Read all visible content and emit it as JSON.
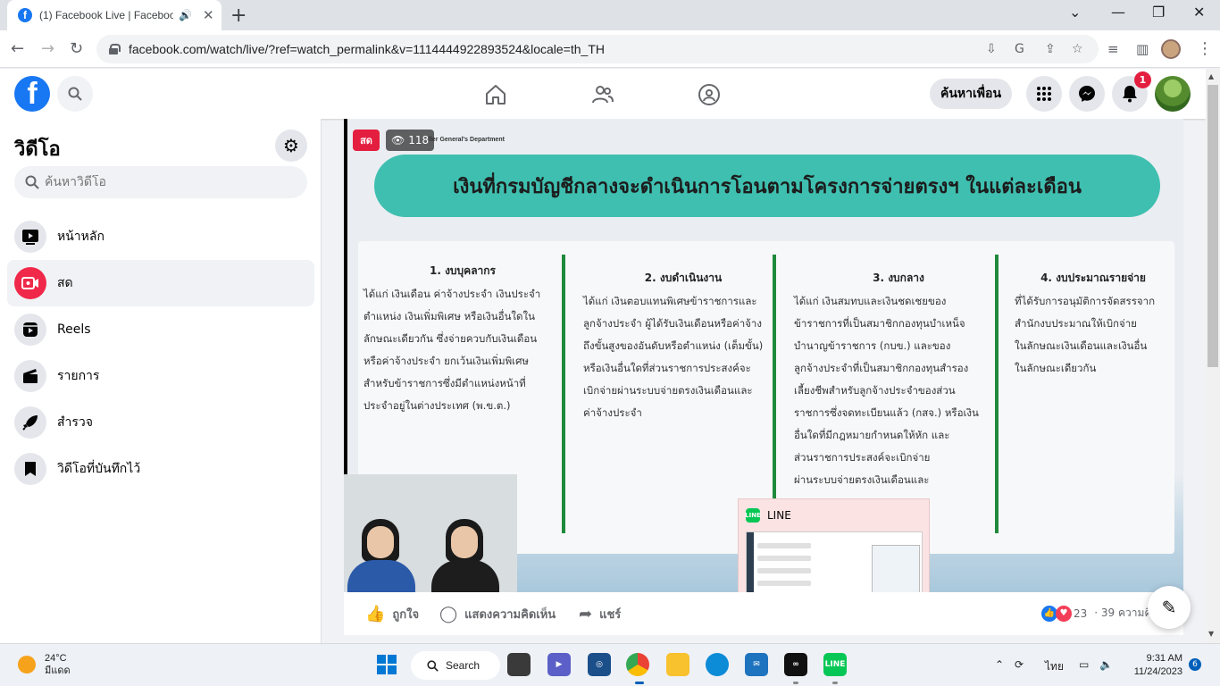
{
  "browser": {
    "tab_title": "(1) Facebook Live | Facebook",
    "url": "facebook.com/watch/live/?ref=watch_permalink&v=1114444922893524&locale=th_TH"
  },
  "header": {
    "find_friends": "ค้นหาเพื่อน",
    "notification_count": "1"
  },
  "sidebar": {
    "title": "วิดีโอ",
    "search_placeholder": "ค้นหาวิดีโอ",
    "items": [
      {
        "label": "หน้าหลัก",
        "icon": "play-icon"
      },
      {
        "label": "สด",
        "icon": "live-icon"
      },
      {
        "label": "Reels",
        "icon": "reels-icon"
      },
      {
        "label": "รายการ",
        "icon": "clapper-icon"
      },
      {
        "label": "สำรวจ",
        "icon": "rocket-icon"
      },
      {
        "label": "วิดีโอที่บันทึกไว้",
        "icon": "bookmark-icon"
      }
    ]
  },
  "video": {
    "live_label": "สด",
    "viewer_count": "118",
    "dept_text": "ller General's Department",
    "slide": {
      "title": "เงินที่กรมบัญชีกลางจะดำเนินการโอนตามโครงการจ่ายตรงฯ ในแต่ละเดือน",
      "columns": [
        {
          "heading": "1. งบบุคลากร",
          "lines": [
            "ได้แก่ เงินเดือน ค่าจ้างประจำ เงินประจำ",
            "ตำแหน่ง เงินเพิ่มพิเศษ หรือเงินอื่นใดใน",
            "ลักษณะเดียวกัน ซึ่งจ่ายควบกับเงินเดือน",
            "หรือค่าจ้างประจำ ยกเว้นเงินเพิ่มพิเศษ",
            "สำหรับข้าราชการซึ่งมีตำแหน่งหน้าที่",
            "ประจำอยู่ในต่างประเทศ (พ.ข.ต.)"
          ]
        },
        {
          "heading": "2. งบดำเนินงาน",
          "lines": [
            "ได้แก่ เงินตอบแทนพิเศษข้าราชการและ",
            "ลูกจ้างประจำ ผู้ได้รับเงินเดือนหรือค่าจ้าง",
            "ถึงขั้นสูงของอันดับหรือตำแหน่ง (เต็มขั้น)",
            "หรือเงินอื่นใดที่ส่วนราชการประสงค์จะ",
            "เบิกจ่ายผ่านระบบจ่ายตรงเงินเดือนและ",
            "ค่าจ้างประจำ"
          ]
        },
        {
          "heading": "3. งบกลาง",
          "lines": [
            "ได้แก่ เงินสมทบและเงินชดเชยของ",
            "ข้าราชการที่เป็นสมาชิกกองทุนบำเหน็จ",
            "บำนาญข้าราชการ (กบข.) และของ",
            "ลูกจ้างประจำที่เป็นสมาชิกกองทุนสำรอง",
            "เลี้ยงชีพสำหรับลูกจ้างประจำของส่วน",
            "ราชการซึ่งจดทะเบียนแล้ว (กสจ.) หรือเงิน",
            "อื่นใดที่มีกฎหมายกำหนดให้หัก และ",
            "ส่วนราชการประสงค์จะเบิกจ่าย",
            "ผ่านระบบจ่ายตรงเงินเดือนและ"
          ]
        },
        {
          "heading": "4. งบประมาณรายจ่าย",
          "lines": [
            "ที่ได้รับการอนุมัติการจัดสรรจาก",
            "สำนักงบประมาณให้เบิกจ่าย",
            "ในลักษณะเงินเดือนและเงินอื่น",
            "ในลักษณะเดียวกัน"
          ]
        }
      ]
    }
  },
  "line_popup": {
    "title": "LINE"
  },
  "actions": {
    "like": "ถูกใจ",
    "comment": "แสดงความคิดเห็น",
    "share": "แชร์",
    "reaction_count": "23",
    "comment_count": "· 39 ความคิ"
  },
  "taskbar": {
    "temperature": "24°C",
    "weather_desc": "มีแดด",
    "search_label": "Search",
    "language": "ไทย",
    "time": "9:31 AM",
    "date": "11/24/2023",
    "notification_count": "6"
  },
  "colors": {
    "fb_blue": "#1877f2",
    "slide_teal": "#3fbfb0",
    "divider_green": "#1f8a3c",
    "live_red": "#e41e3f"
  }
}
